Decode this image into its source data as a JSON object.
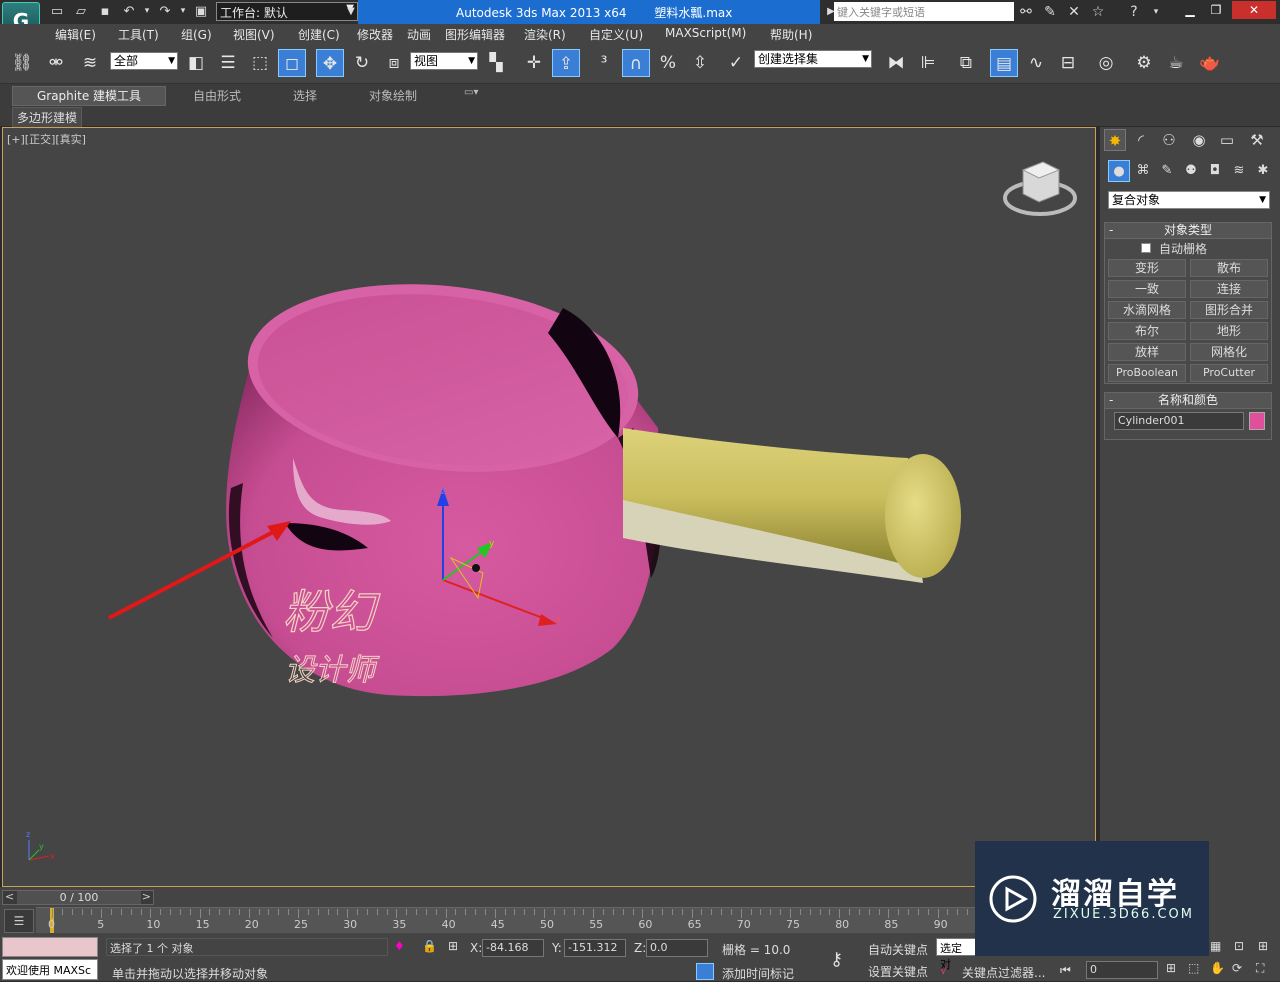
{
  "title_bar": {
    "workspace_label": "工作台: 默认",
    "app_title": "Autodesk 3ds Max  2013 x64",
    "file_name": "塑料水瓢.max",
    "search_placeholder": "键入关键字或短语"
  },
  "menu": [
    "编辑(E)",
    "工具(T)",
    "组(G)",
    "视图(V)",
    "创建(C)",
    "修改器",
    "动画",
    "图形编辑器",
    "渲染(R)",
    "自定义(U)",
    "MAXScript(M)",
    "帮助(H)"
  ],
  "toolbar": {
    "filter_value": "全部",
    "ref_coord_value": "视图",
    "selection_set_value": "创建选择集"
  },
  "ribbon": {
    "tabs": [
      "Graphite 建模工具",
      "自由形式",
      "选择",
      "对象绘制"
    ],
    "sub_label": "多边形建模"
  },
  "viewport": {
    "label": "[+][正交][真实]",
    "axis_x": "x",
    "axis_y": "y",
    "axis_z": "z",
    "calligraphy_top": "粉幻",
    "calligraphy_bottom": "设计师"
  },
  "command_panel": {
    "category_value": "复合对象",
    "object_type": {
      "header": "对象类型",
      "autogrid_label": "自动栅格",
      "buttons": [
        "变形",
        "散布",
        "一致",
        "连接",
        "水滴网格",
        "图形合并",
        "布尔",
        "地形",
        "放样",
        "网格化",
        "ProBoolean",
        "ProCutter"
      ]
    },
    "name_color": {
      "header": "名称和颜色",
      "object_name": "Cylinder001",
      "color": "#e0509a"
    }
  },
  "timeline": {
    "frame_display": "0 / 100",
    "ticks": [
      "0",
      "5",
      "10",
      "15",
      "20",
      "25",
      "30",
      "35",
      "40",
      "45",
      "50",
      "55",
      "60",
      "65",
      "70",
      "75",
      "80",
      "85",
      "90"
    ]
  },
  "status": {
    "maxscript_label": "欢迎使用 MAXSc",
    "selection_info": "选择了 1 个 对象",
    "prompt": "单击并拖动以选择并移动对象",
    "x_label": "X:",
    "x_value": "-84.168",
    "y_label": "Y:",
    "y_value": "-151.312",
    "z_label": "Z:",
    "z_value": "0.0",
    "grid": "栅格 = 10.0",
    "add_time_tag": "添加时间标记",
    "auto_key": "自动关键点",
    "set_key": "设置关键点",
    "selected_value": "选定对",
    "key_filters": "关键点过滤器...",
    "frame_value": "0"
  },
  "watermark": {
    "title": "溜溜自学",
    "subtitle": "ZIXUE.3D66.COM"
  }
}
